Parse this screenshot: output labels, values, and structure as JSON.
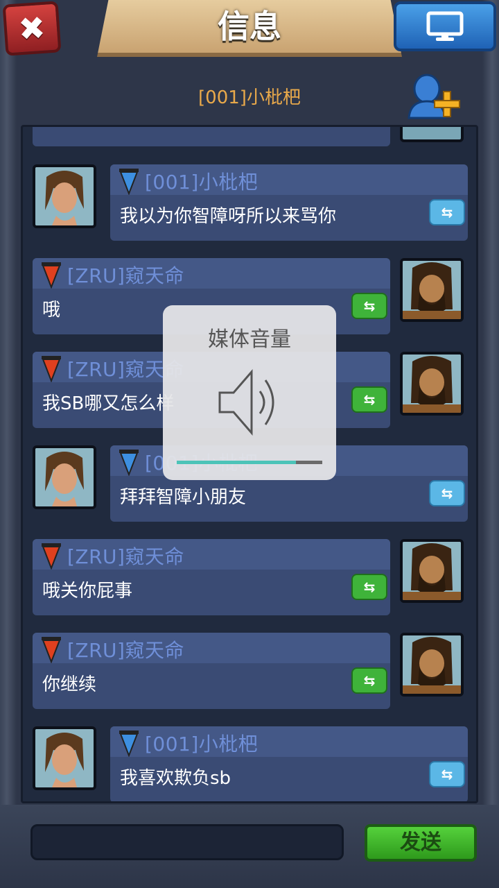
{
  "header": {
    "title": "信息",
    "chat_target": "[001]小枇杷"
  },
  "messages": [
    {
      "side": "left",
      "name": "[001]小枇杷",
      "text": "我以为你智障呀所以来骂你",
      "flag": "blue"
    },
    {
      "side": "right",
      "name": "[ZRU]窥天命",
      "text": "哦",
      "flag": "red"
    },
    {
      "side": "right",
      "name": "[ZRU]窥天命",
      "text": "我SB哪又怎么样",
      "flag": "red"
    },
    {
      "side": "left",
      "name": "[001]小枇杷",
      "text": "拜拜智障小朋友",
      "flag": "blue"
    },
    {
      "side": "right",
      "name": "[ZRU]窥天命",
      "text": "哦关你屁事",
      "flag": "red"
    },
    {
      "side": "right",
      "name": "[ZRU]窥天命",
      "text": "你继续",
      "flag": "red"
    },
    {
      "side": "left",
      "name": "[001]小枇杷",
      "text": "我喜欢欺负sb",
      "flag": "blue"
    }
  ],
  "input": {
    "value": "",
    "send_label": "发送"
  },
  "volume_overlay": {
    "title": "媒体音量",
    "level": 0.82
  },
  "colors": {
    "name_blue": "#6f8fd8",
    "chat_target": "#e9a94a",
    "send_green": "#3fb33a",
    "volume_fill": "#4cc3b8"
  }
}
